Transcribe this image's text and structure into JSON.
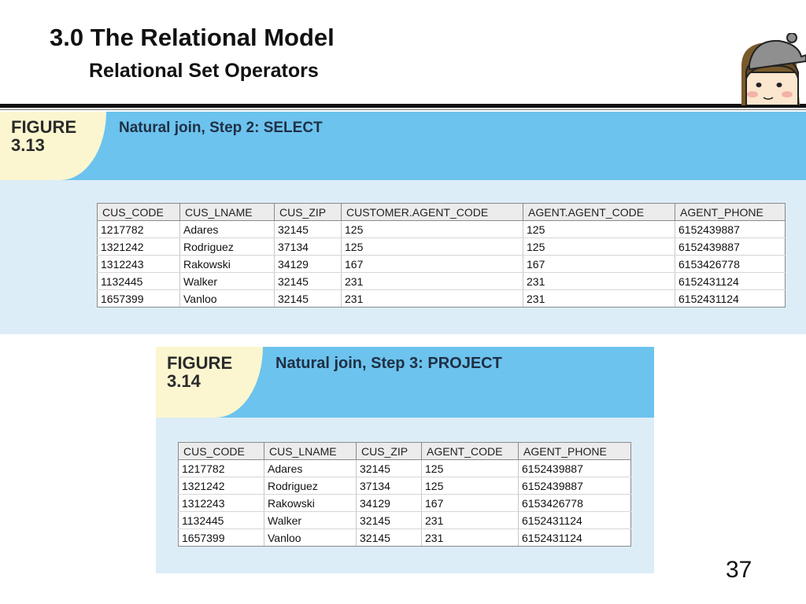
{
  "slide": {
    "title": "3.0 The Relational Model",
    "subtitle": "Relational Set Operators",
    "page_number": "37"
  },
  "figure_313": {
    "label_line1": "FIGURE",
    "label_line2": "3.13",
    "title": "Natural join, Step 2: SELECT",
    "columns": [
      "CUS_CODE",
      "CUS_LNAME",
      "CUS_ZIP",
      "CUSTOMER.AGENT_CODE",
      "AGENT.AGENT_CODE",
      "AGENT_PHONE"
    ],
    "rows": [
      [
        "1217782",
        "Adares",
        "32145",
        "125",
        "125",
        "6152439887"
      ],
      [
        "1321242",
        "Rodriguez",
        "37134",
        "125",
        "125",
        "6152439887"
      ],
      [
        "1312243",
        "Rakowski",
        "34129",
        "167",
        "167",
        "6153426778"
      ],
      [
        "1132445",
        "Walker",
        "32145",
        "231",
        "231",
        "6152431124"
      ],
      [
        "1657399",
        "Vanloo",
        "32145",
        "231",
        "231",
        "6152431124"
      ]
    ]
  },
  "figure_314": {
    "label_line1": "FIGURE",
    "label_line2": "3.14",
    "title": "Natural join, Step 3: PROJECT",
    "columns": [
      "CUS_CODE",
      "CUS_LNAME",
      "CUS_ZIP",
      "AGENT_CODE",
      "AGENT_PHONE"
    ],
    "rows": [
      [
        "1217782",
        "Adares",
        "32145",
        "125",
        "6152439887"
      ],
      [
        "1321242",
        "Rodriguez",
        "37134",
        "125",
        "6152439887"
      ],
      [
        "1312243",
        "Rakowski",
        "34129",
        "167",
        "6153426778"
      ],
      [
        "1132445",
        "Walker",
        "32145",
        "231",
        "6152431124"
      ],
      [
        "1657399",
        "Vanloo",
        "32145",
        "231",
        "6152431124"
      ]
    ]
  },
  "colors": {
    "header_blue": "#6cc3ee",
    "panel_light_blue": "#dcedf8",
    "tab_cream": "#fbf6cf"
  },
  "icons": {
    "mascot": "cartoon-person-with-cap-icon"
  }
}
